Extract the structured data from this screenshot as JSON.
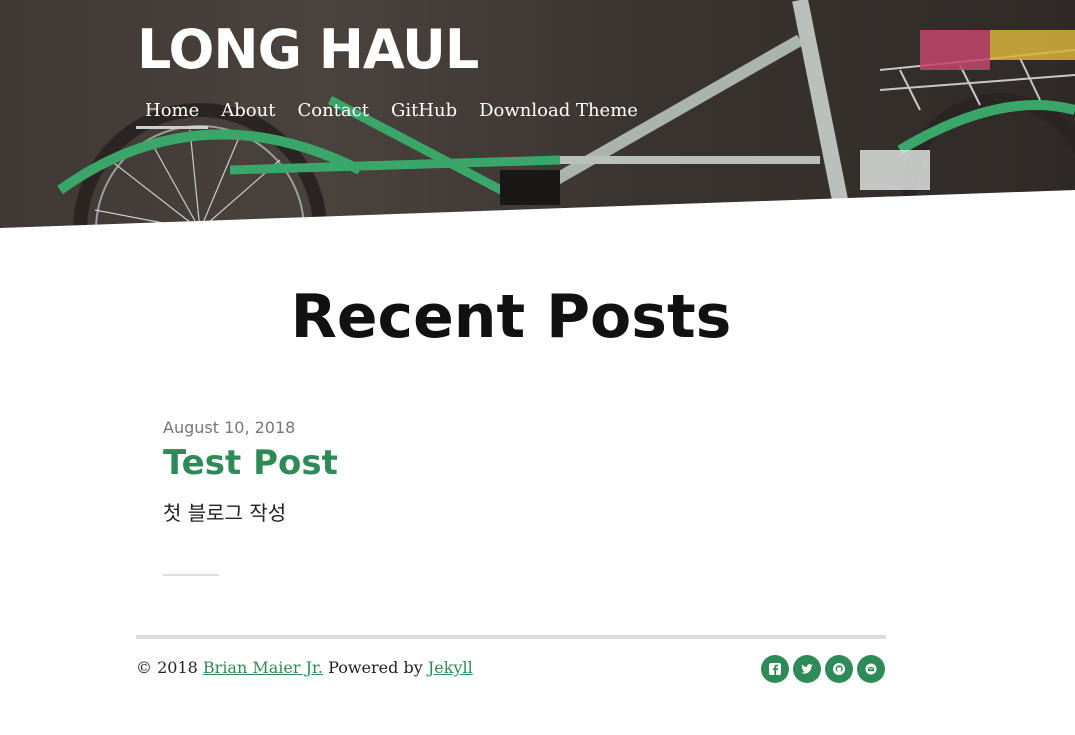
{
  "site": {
    "title": "LONG HAUL"
  },
  "nav": {
    "items": [
      {
        "label": "Home"
      },
      {
        "label": "About"
      },
      {
        "label": "Contact"
      },
      {
        "label": "GitHub"
      },
      {
        "label": "Download Theme"
      }
    ],
    "active": "Home"
  },
  "main": {
    "heading": "Recent Posts",
    "posts": [
      {
        "date": "August 10, 2018",
        "title": "Test Post",
        "excerpt": "첫 블로그 작성"
      }
    ]
  },
  "footer": {
    "copyright": "© 2018",
    "author": "Brian Maier Jr.",
    "powered_by": "Powered by",
    "engine": "Jekyll",
    "social": [
      {
        "icon": "facebook-icon"
      },
      {
        "icon": "twitter-icon"
      },
      {
        "icon": "github-icon"
      },
      {
        "icon": "email-icon"
      }
    ]
  },
  "colors": {
    "accent": "#2e8b57",
    "header_bg": "#3f3834",
    "rule": "#dddddd"
  }
}
